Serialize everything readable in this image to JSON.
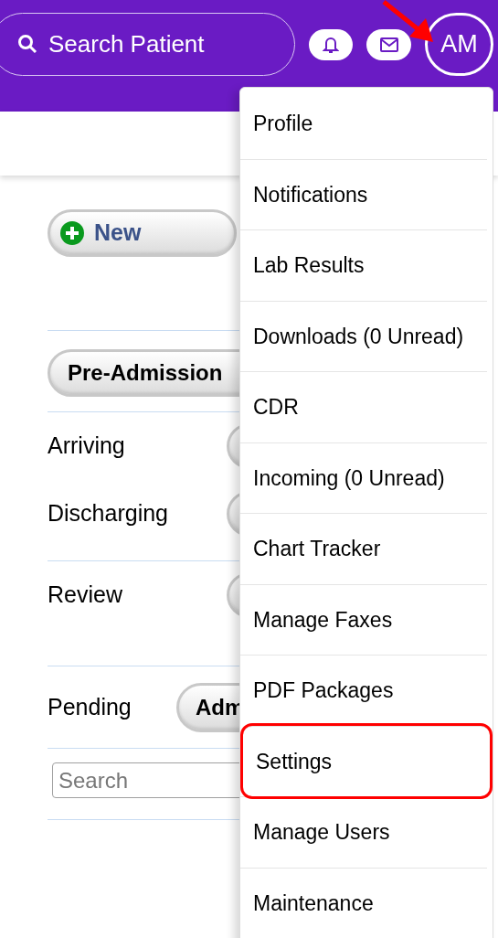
{
  "header": {
    "search": {
      "placeholder": "Search Patient"
    },
    "avatar": "AM"
  },
  "new_button": "New",
  "pre_admission_button": "Pre-Admission",
  "rows": [
    {
      "label": "Arriving"
    },
    {
      "label": "Discharging"
    },
    {
      "label": "Review"
    }
  ],
  "pending": {
    "label": "Pending",
    "button": "Adm"
  },
  "search": {
    "placeholder": "Search"
  },
  "menu": {
    "items": [
      {
        "label": "Profile",
        "highlighted": false
      },
      {
        "label": "Notifications",
        "highlighted": false
      },
      {
        "label": "Lab Results",
        "highlighted": false
      },
      {
        "label": "Downloads (0 Unread)",
        "highlighted": false
      },
      {
        "label": "CDR",
        "highlighted": false
      },
      {
        "label": "Incoming (0 Unread)",
        "highlighted": false
      },
      {
        "label": "Chart Tracker",
        "highlighted": false
      },
      {
        "label": "Manage Faxes",
        "highlighted": false
      },
      {
        "label": "PDF Packages",
        "highlighted": false
      },
      {
        "label": "Settings",
        "highlighted": true
      },
      {
        "label": "Manage Users",
        "highlighted": false
      },
      {
        "label": "Maintenance",
        "highlighted": false
      }
    ]
  }
}
